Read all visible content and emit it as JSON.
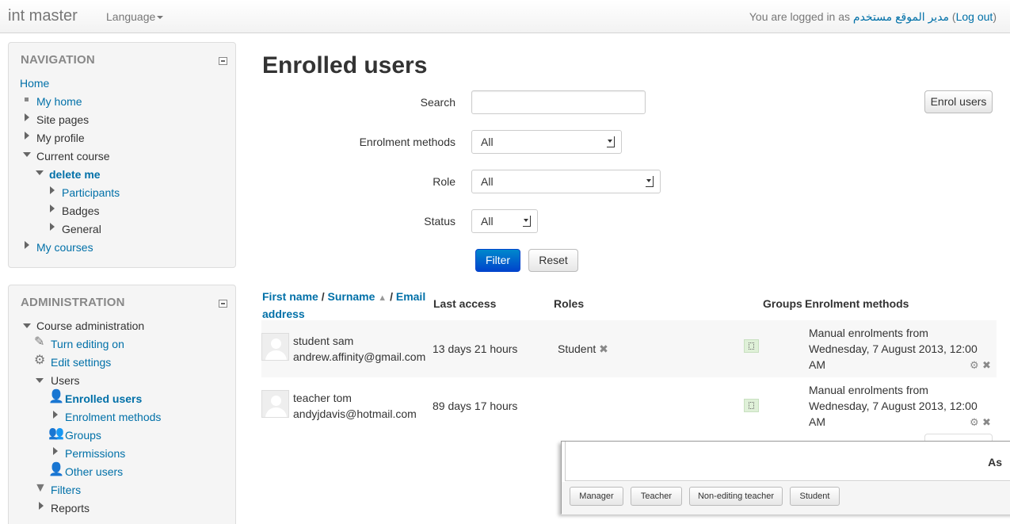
{
  "navbar": {
    "brand": "int master",
    "language": "Language",
    "login_prefix": "You are logged in as ",
    "user_name": "مدير الموقع مستخدم",
    "logout": "Log out"
  },
  "navigation": {
    "title": "NAVIGATION",
    "home": "Home",
    "my_home": "My home",
    "site_pages": "Site pages",
    "my_profile": "My profile",
    "current_course": "Current course",
    "course_name": "delete me",
    "participants": "Participants",
    "badges": "Badges",
    "general": "General",
    "my_courses": "My courses"
  },
  "administration": {
    "title": "ADMINISTRATION",
    "course_admin": "Course administration",
    "turn_editing_on": "Turn editing on",
    "edit_settings": "Edit settings",
    "users": "Users",
    "enrolled_users": "Enrolled users",
    "enrolment_methods": "Enrolment methods",
    "groups": "Groups",
    "permissions": "Permissions",
    "other_users": "Other users",
    "filters": "Filters",
    "reports": "Reports"
  },
  "main": {
    "title": "Enrolled users",
    "enrol_users_button": "Enrol users",
    "filter": {
      "search_label": "Search",
      "search_value": "",
      "enrolment_methods_label": "Enrolment methods",
      "enrolment_methods_value": "All",
      "role_label": "Role",
      "role_value": "All",
      "status_label": "Status",
      "status_value": "All",
      "filter_button": "Filter",
      "reset_button": "Reset"
    },
    "table": {
      "header_first_name": "First name",
      "header_surname": "Surname",
      "header_email_a": "Email",
      "header_email_b": "address",
      "header_last_access": "Last access",
      "header_roles": "Roles",
      "header_groups": "Groups",
      "header_enrolment_methods": "Enrolment methods",
      "rows": [
        {
          "name": "student sam",
          "email": "andrew.affinity@gmail.com",
          "last_access": "13 days 21 hours",
          "role": "Student",
          "method_line1": "Manual enrolments from",
          "method_line2": "Wednesday, 7 August 2013, 12:00",
          "method_line3": "AM"
        },
        {
          "name": "teacher tom",
          "email": "andyjdavis@hotmail.com",
          "last_access": "89 days 17 hours",
          "role": "",
          "method_line1": "Manual enrolments from",
          "method_line2": "Wednesday, 7 August 2013, 12:00",
          "method_line3": "AM"
        }
      ]
    }
  },
  "dialog": {
    "title": "As",
    "roles": [
      "Manager",
      "Teacher",
      "Non-editing teacher",
      "Student"
    ]
  }
}
